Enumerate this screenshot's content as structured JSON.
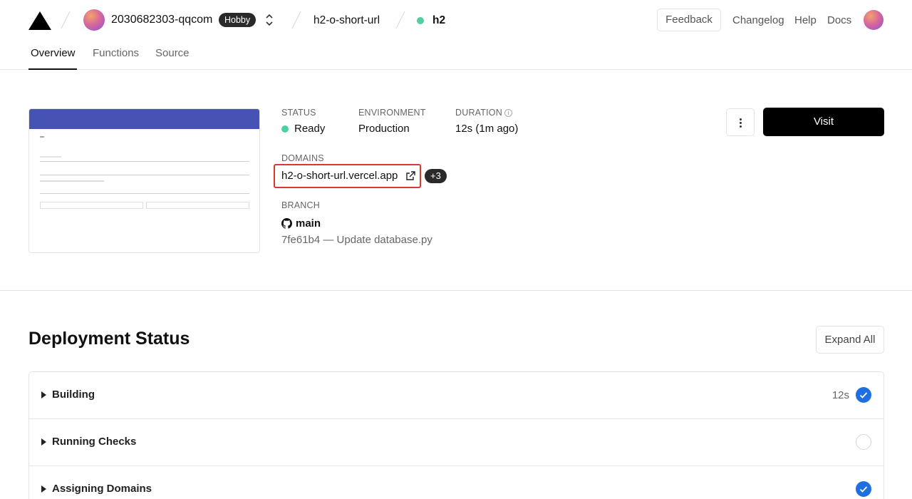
{
  "header": {
    "team_name": "2030682303-qqcom",
    "plan_badge": "Hobby",
    "project_name": "h2-o-short-url",
    "deployment_name": "h2",
    "nav": {
      "feedback": "Feedback",
      "changelog": "Changelog",
      "help": "Help",
      "docs": "Docs"
    }
  },
  "tabs": [
    {
      "label": "Overview",
      "active": true
    },
    {
      "label": "Functions",
      "active": false
    },
    {
      "label": "Source",
      "active": false
    }
  ],
  "deployment": {
    "status_label": "STATUS",
    "status_value": "Ready",
    "environment_label": "ENVIRONMENT",
    "environment_value": "Production",
    "duration_label": "DURATION",
    "duration_value": "12s  (1m ago)",
    "domains_label": "DOMAINS",
    "domain": "h2-o-short-url.vercel.app",
    "more_domains": "+3",
    "branch_label": "BRANCH",
    "branch": "main",
    "commit": "7fe61b4 — Update database.py",
    "visit_label": "Visit"
  },
  "deployment_status": {
    "title": "Deployment Status",
    "expand_label": "Expand All",
    "steps": [
      {
        "label": "Building",
        "time": "12s",
        "state": "done"
      },
      {
        "label": "Running Checks",
        "time": "",
        "state": "pending"
      },
      {
        "label": "Assigning Domains",
        "time": "",
        "state": "done"
      }
    ]
  },
  "colors": {
    "accent_blue": "#1f6fe0",
    "ready_green": "#50d0a0",
    "highlight_red": "#d8392c",
    "preview_bar": "#4653b4"
  },
  "icons": [
    "vercel-logo-icon",
    "chevron-updown-icon",
    "info-icon",
    "external-link-icon",
    "github-icon",
    "kebab-menu-icon",
    "caret-right-icon",
    "check-circle-icon"
  ]
}
